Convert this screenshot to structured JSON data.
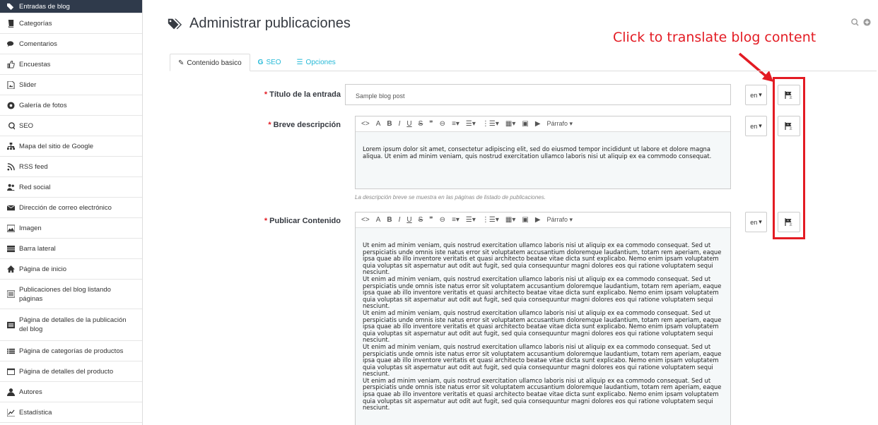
{
  "sidebar": {
    "items": [
      {
        "label": "Entradas de blog",
        "icon": "tags-icon",
        "active": true
      },
      {
        "label": "Categorías",
        "icon": "book-icon"
      },
      {
        "label": "Comentarios",
        "icon": "comments-icon"
      },
      {
        "label": "Encuestas",
        "icon": "thumbs-up-icon"
      },
      {
        "label": "Slider",
        "icon": "image-file-icon"
      },
      {
        "label": "Galería de fotos",
        "icon": "gallery-icon"
      },
      {
        "label": "SEO",
        "icon": "seo-icon"
      },
      {
        "label": "Mapa del sitio de Google",
        "icon": "sitemap-icon"
      },
      {
        "label": "RSS feed",
        "icon": "rss-icon"
      },
      {
        "label": "Red social",
        "icon": "users-icon"
      },
      {
        "label": "Dirección de correo electrónico",
        "icon": "envelope-icon"
      },
      {
        "label": "Imagen",
        "icon": "picture-icon"
      },
      {
        "label": "Barra lateral",
        "icon": "sidebar-icon"
      },
      {
        "label": "Página de inicio",
        "icon": "home-icon"
      },
      {
        "label": "Publicaciones del blog listando páginas",
        "icon": "list-page-icon"
      },
      {
        "label": "Página de detalles de la publicación del blog",
        "icon": "detail-page-icon"
      },
      {
        "label": "Página de categorías de productos",
        "icon": "list-icon"
      },
      {
        "label": "Página de detalles del producto",
        "icon": "window-icon"
      },
      {
        "label": "Autores",
        "icon": "user-icon"
      },
      {
        "label": "Estadística",
        "icon": "chart-icon"
      }
    ]
  },
  "header": {
    "title": "Administrar publicaciones",
    "icons": [
      "zoom-icon",
      "add-circle-icon"
    ]
  },
  "annotation": "Click to translate blog content",
  "tabs": [
    {
      "label": "Contenido basico",
      "icon": "edit-icon",
      "active": true
    },
    {
      "label": "SEO",
      "icon": "google-icon"
    },
    {
      "label": "Opciones",
      "icon": "list-icon"
    }
  ],
  "form": {
    "required_mark": "*",
    "title": {
      "label": "Título de la entrada",
      "value": "Sample blog post"
    },
    "short_desc": {
      "label": "Breve descripción",
      "text": "Lorem ipsum dolor sit amet, consectetur adipiscing elit, sed do eiusmod tempor incididunt ut labore et dolore magna aliqua. Ut enim ad minim veniam, quis nostrud exercitation ullamco laboris nisi ut aliquip ex ea commodo consequat.",
      "help": "La descripción breve se muestra en las páginas de listado de publicaciones."
    },
    "content": {
      "label": "Publicar Contenido",
      "paragraph": "Ut enim ad minim veniam, quis nostrud exercitation ullamco laboris nisi ut aliquip ex ea commodo consequat. Sed ut perspiciatis unde omnis iste natus error sit voluptatem accusantium doloremque laudantium, totam rem aperiam, eaque ipsa quae ab illo inventore veritatis et quasi architecto beatae vitae dicta sunt explicabo. Nemo enim ipsam voluptatem quia voluptas sit aspernatur aut odit aut fugit, sed quia consequuntur magni dolores eos qui ratione voluptatem sequi nesciunt."
    },
    "lang": "en",
    "toolbar_format": "Párrafo"
  },
  "colors": {
    "accent": "#25b9d7",
    "annotation": "#e31b23",
    "sidebar_active": "#2f3a4b"
  }
}
